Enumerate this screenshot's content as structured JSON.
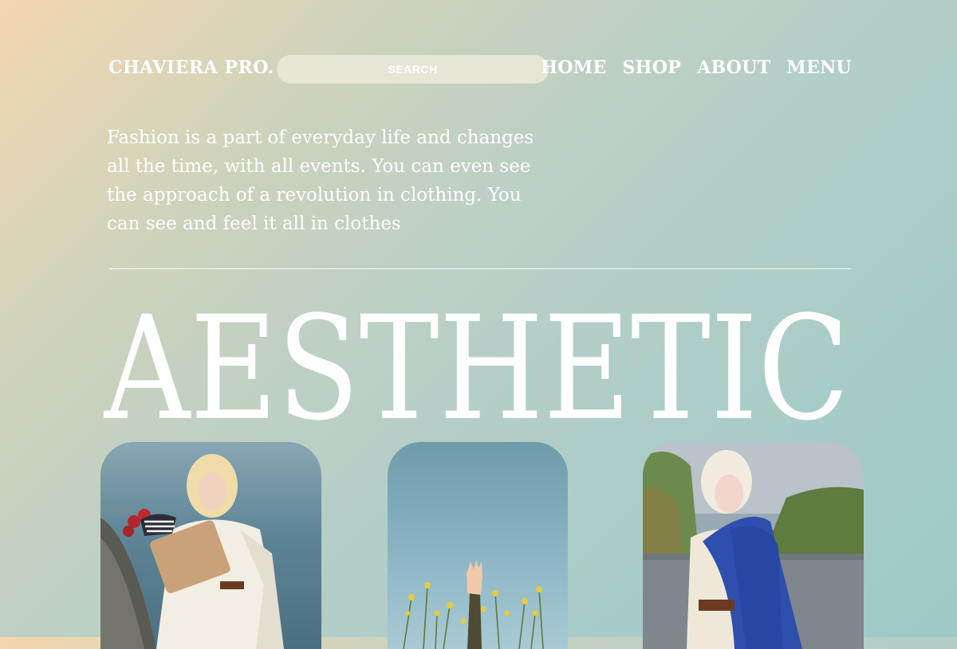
{
  "header": {
    "logo": "CHAVIERA PRO.",
    "search_label": "SEARCH",
    "nav": [
      "HOME",
      "SHOP",
      "ABOUT",
      "MENU"
    ]
  },
  "intro": {
    "text": "Fashion is a part of everyday life and changes all the time, with all events. You can even see the approach of a revolution in clothing. You can see and feel it all in clothes"
  },
  "headline": {
    "text": "AESTHETIC"
  },
  "colors": {
    "background_start": "#f3d7b0",
    "background_end": "#9ec9c7",
    "text": "#ffffff"
  },
  "gallery": [
    {
      "name": "photo-woman-with-flowers"
    },
    {
      "name": "photo-hand-in-field"
    },
    {
      "name": "photo-woman-with-blue-cape"
    }
  ]
}
